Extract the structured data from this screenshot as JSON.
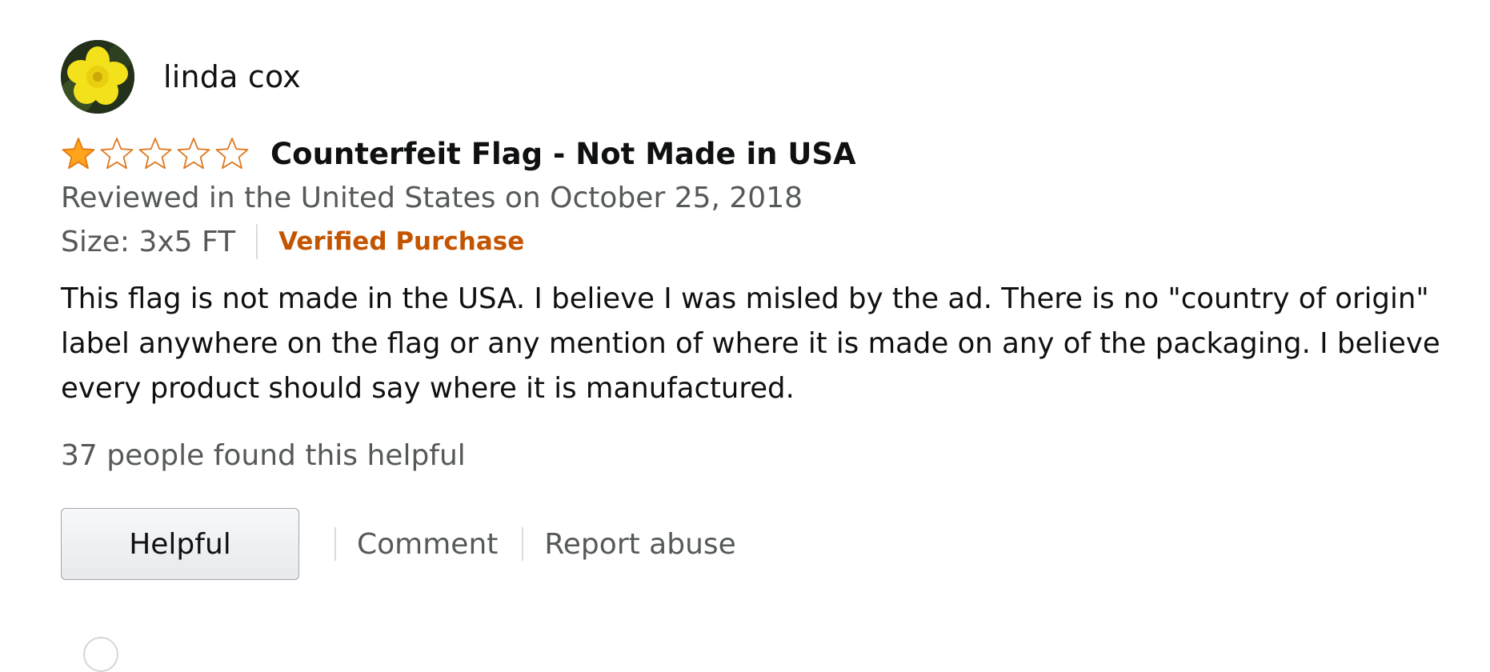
{
  "profile": {
    "name": "linda cox",
    "avatar_icon": "yellow-flower-avatar"
  },
  "review": {
    "rating": 1,
    "rating_max": 5,
    "star_color": "#ffa41c",
    "title": "Counterfeit Flag - Not Made in USA",
    "date": "Reviewed in the United States on October 25, 2018",
    "size": "Size: 3x5 FT",
    "verified": "Verified Purchase",
    "verified_color": "#c45500",
    "body": "This flag is not made in the USA. I believe I was misled by the ad. There is no \"country of origin\" label anywhere on the flag or any mention of where it is made on any of the packaging. I believe every product should say where it is manufactured.",
    "helpful_count": "37 people found this helpful"
  },
  "actions": {
    "helpful_label": "Helpful",
    "comment_label": "Comment",
    "report_label": "Report abuse"
  }
}
